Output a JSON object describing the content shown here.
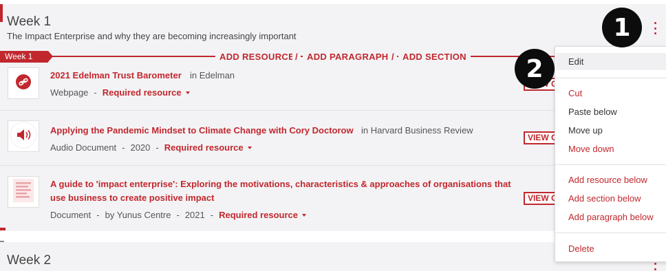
{
  "week1": {
    "title": "Week 1",
    "subtitle": "The Impact Enterprise and why they are becoming increasingly important",
    "tag": "Week 1",
    "actions": {
      "add_resource": "ADD RESOURCE",
      "add_paragraph": "ADD PARAGRAPH",
      "add_section": "ADD SECTION",
      "separator": "/"
    },
    "items": [
      {
        "title": "2021 Edelman Trust Barometer",
        "in_text": "in Edelman",
        "icon": "link-icon",
        "type": "Webpage",
        "requirement": "Required resource"
      },
      {
        "title": "Applying the Pandemic Mindset to Climate Change with Cory Doctorow",
        "in_text": "in Harvard Business Review",
        "icon": "speaker-icon",
        "type": "Audio Document",
        "year": "2020",
        "requirement": "Required resource",
        "button": "VIEW ONLINE"
      },
      {
        "title_line1": "A guide to 'impact enterprise': Exploring the motivations, characteristics & approaches of organisations that",
        "title_line2": "use business to create positive impact",
        "icon": "document-icon",
        "type": "Document",
        "author": "by Yunus Centre",
        "year": "2021",
        "requirement": "Required resource",
        "button": "VIEW ONLINE"
      }
    ],
    "meta_separator": "-"
  },
  "week2": {
    "title": "Week 2"
  },
  "menu": {
    "edit": "Edit",
    "cut": "Cut",
    "paste_below": "Paste below",
    "move_up": "Move up",
    "move_down": "Move down",
    "add_resource_below": "Add resource below",
    "add_section_below": "Add section below",
    "add_paragraph_below": "Add paragraph below",
    "delete": "Delete"
  },
  "callouts": {
    "one": "1",
    "two": "2"
  },
  "colors": {
    "accent": "#c1272d",
    "section_bg": "#f3f3f5",
    "callout": "#0c0c0c"
  }
}
